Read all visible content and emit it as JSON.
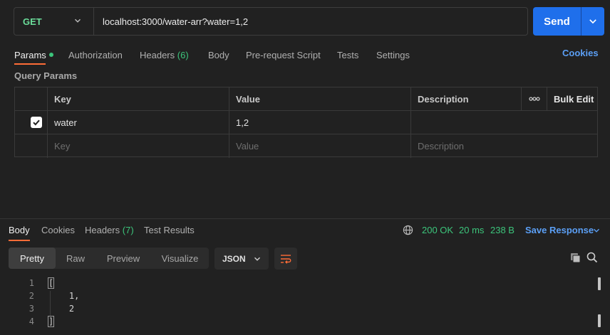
{
  "request": {
    "method": "GET",
    "url": "localhost:3000/water-arr?water=1,2",
    "send_label": "Send"
  },
  "request_tabs": [
    {
      "label": "Params",
      "active": true
    },
    {
      "label": "Authorization"
    },
    {
      "label": "Headers",
      "count": "(6)"
    },
    {
      "label": "Body"
    },
    {
      "label": "Pre-request Script"
    },
    {
      "label": "Tests"
    },
    {
      "label": "Settings"
    }
  ],
  "cookies_link": "Cookies",
  "query_params": {
    "title": "Query Params",
    "columns": {
      "key": "Key",
      "value": "Value",
      "description": "Description",
      "bulk_edit": "Bulk Edit"
    },
    "rows": [
      {
        "checked": true,
        "key": "water",
        "value": "1,2",
        "description": ""
      }
    ],
    "placeholder": {
      "key": "Key",
      "value": "Value",
      "description": "Description"
    }
  },
  "response_tabs": [
    {
      "label": "Body",
      "active": true
    },
    {
      "label": "Cookies"
    },
    {
      "label": "Headers",
      "count": "(7)"
    },
    {
      "label": "Test Results"
    }
  ],
  "response_status": {
    "status": "200 OK",
    "time": "20 ms",
    "size": "238 B",
    "save_label": "Save Response"
  },
  "view_modes": [
    "Pretty",
    "Raw",
    "Preview",
    "Visualize"
  ],
  "format": "JSON",
  "code_lines": [
    {
      "num": "1",
      "text": "["
    },
    {
      "num": "2",
      "text": "    1,"
    },
    {
      "num": "3",
      "text": "    2"
    },
    {
      "num": "4",
      "text": "]"
    }
  ],
  "colors": {
    "accent": "#ff6c37",
    "send": "#1f6feb",
    "success": "#3cc57b",
    "link": "#5b9ff5"
  }
}
